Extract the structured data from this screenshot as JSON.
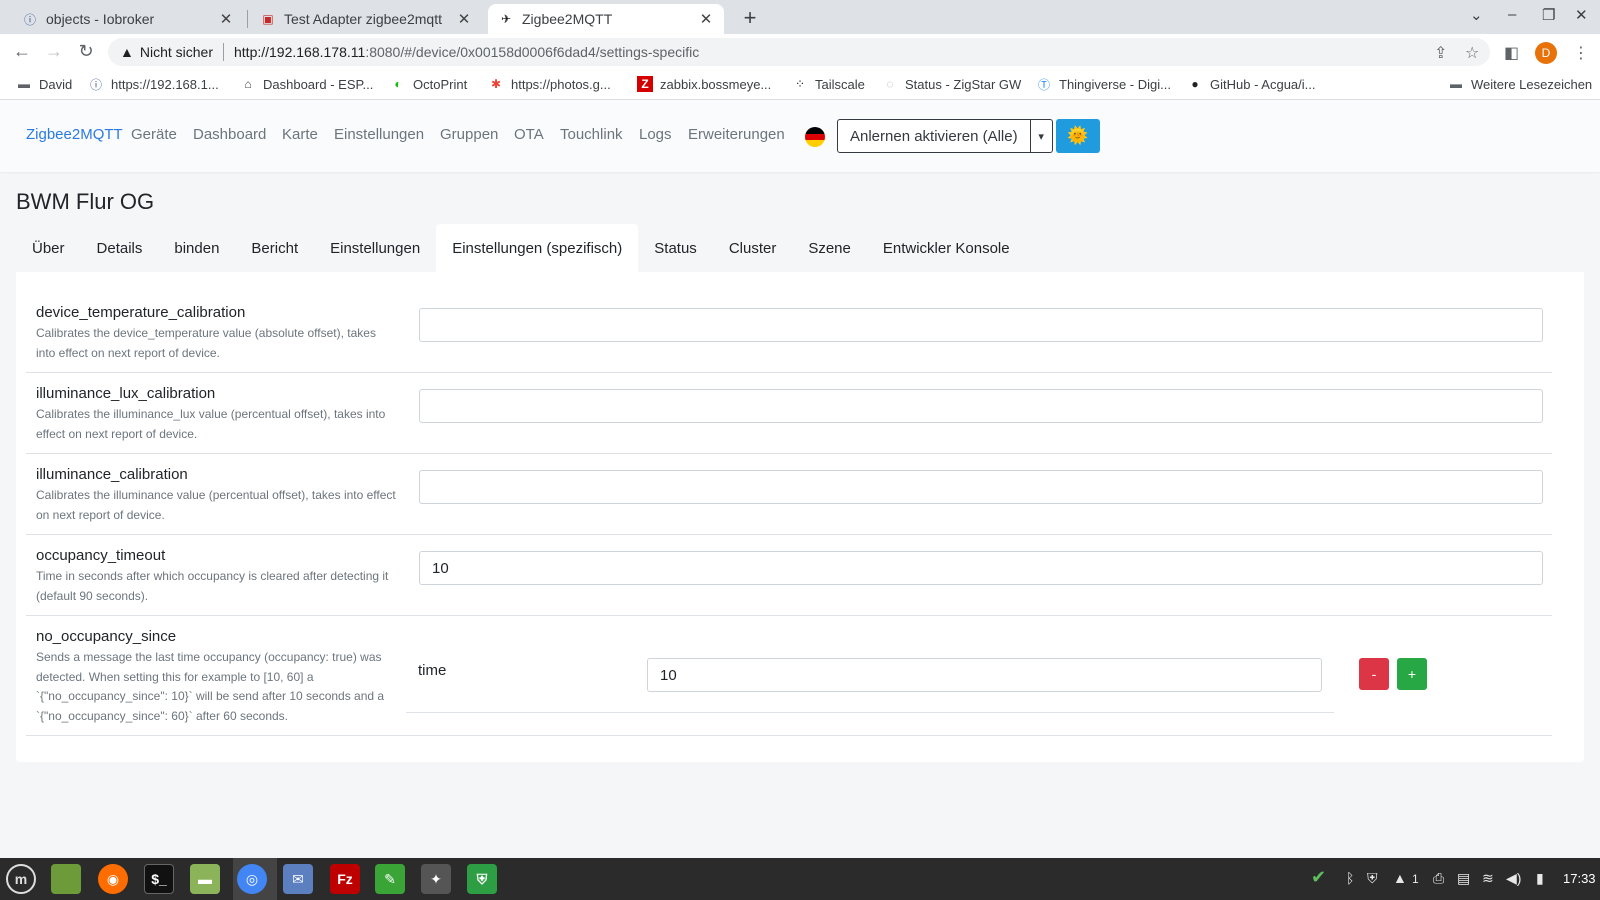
{
  "browser": {
    "tabs": [
      {
        "title": "objects - Iobroker",
        "icon": "iobroker-icon"
      },
      {
        "title": "Test Adapter zigbee2mqtt",
        "icon": "forum-icon"
      },
      {
        "title": "Zigbee2MQTT",
        "icon": "zigbee-bee-icon"
      }
    ],
    "address": {
      "security": "Nicht sicher",
      "host": "http://192.168.178.11",
      "path": ":8080/#/device/0x00158d0006f6dad4/settings-specific"
    },
    "profile_initial": "D",
    "bookmarks": [
      {
        "label": "David"
      },
      {
        "label": "https://192.168.1..."
      },
      {
        "label": "Dashboard - ESP..."
      },
      {
        "label": "OctoPrint"
      },
      {
        "label": "https://photos.g..."
      },
      {
        "label": "zabbix.bossmeye..."
      },
      {
        "label": "Tailscale"
      },
      {
        "label": "Status - ZigStar GW"
      },
      {
        "label": "Thingiverse - Digi..."
      },
      {
        "label": "GitHub - Acgua/i..."
      },
      {
        "label": "Weitere Lesezeichen"
      }
    ]
  },
  "app": {
    "brand": "Zigbee2MQTT",
    "nav": [
      "Geräte",
      "Dashboard",
      "Karte",
      "Einstellungen",
      "Gruppen",
      "OTA",
      "Touchlink",
      "Logs",
      "Erweiterungen"
    ],
    "permit_join": "Anlernen aktivieren (Alle)",
    "theme_icon": "🌞"
  },
  "device": {
    "title": "BWM Flur OG",
    "tabs": [
      "Über",
      "Details",
      "binden",
      "Bericht",
      "Einstellungen",
      "Einstellungen (spezifisch)",
      "Status",
      "Cluster",
      "Szene",
      "Entwickler Konsole"
    ],
    "active_tab": 5,
    "settings": [
      {
        "name": "device_temperature_calibration",
        "desc": "Calibrates the device_temperature value (absolute offset), takes into effect on next report of device.",
        "value": ""
      },
      {
        "name": "illuminance_lux_calibration",
        "desc": "Calibrates the illuminance_lux value (percentual offset), takes into effect on next report of device.",
        "value": ""
      },
      {
        "name": "illuminance_calibration",
        "desc": "Calibrates the illuminance value (percentual offset), takes into effect on next report of device.",
        "value": ""
      },
      {
        "name": "occupancy_timeout",
        "desc": "Time in seconds after which occupancy is cleared after detecting it (default 90 seconds).",
        "value": "10"
      }
    ],
    "list_setting": {
      "name": "no_occupancy_since",
      "desc": "Sends a message the last time occupancy (occupancy: true) was detected. When setting this for example to [10, 60] a `{\"no_occupancy_since\": 10}` will be send after 10 seconds and a `{\"no_occupancy_since\": 60}` after 60 seconds.",
      "key": "time",
      "value": "10",
      "minus_label": "-",
      "plus_label": "+"
    }
  },
  "taskbar": {
    "tray_count": "1",
    "clock": "17:33"
  }
}
